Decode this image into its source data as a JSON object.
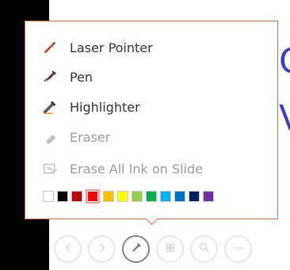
{
  "slide": {
    "visible_text_1": "C",
    "visible_text_2": "V"
  },
  "menu": {
    "items": [
      {
        "label": "Laser Pointer",
        "icon": "laser-pointer-icon",
        "enabled": true
      },
      {
        "label": "Pen",
        "icon": "pen-icon",
        "enabled": true
      },
      {
        "label": "Highlighter",
        "icon": "highlighter-icon",
        "enabled": true
      },
      {
        "label": "Eraser",
        "icon": "eraser-icon",
        "enabled": false
      },
      {
        "label": "Erase All Ink on Slide",
        "icon": "erase-all-ink-icon",
        "enabled": false
      }
    ],
    "colors": [
      {
        "name": "white",
        "hex": "#ffffff",
        "selected": false
      },
      {
        "name": "black",
        "hex": "#000000",
        "selected": false
      },
      {
        "name": "dark-red",
        "hex": "#c00000",
        "selected": false
      },
      {
        "name": "red",
        "hex": "#ff0000",
        "selected": true
      },
      {
        "name": "orange",
        "hex": "#ffc000",
        "selected": false
      },
      {
        "name": "yellow",
        "hex": "#ffff00",
        "selected": false
      },
      {
        "name": "light-green",
        "hex": "#92d050",
        "selected": false
      },
      {
        "name": "green",
        "hex": "#00b050",
        "selected": false
      },
      {
        "name": "light-blue",
        "hex": "#00b0f0",
        "selected": false
      },
      {
        "name": "blue",
        "hex": "#0070c0",
        "selected": false
      },
      {
        "name": "dark-blue",
        "hex": "#002060",
        "selected": false
      },
      {
        "name": "purple",
        "hex": "#7030a0",
        "selected": false
      }
    ],
    "accent_border": "#d66b4f"
  },
  "toolbar": {
    "buttons": [
      {
        "icon": "previous-icon",
        "active": false
      },
      {
        "icon": "next-icon",
        "active": false
      },
      {
        "icon": "pen-tool-icon",
        "active": true
      },
      {
        "icon": "see-all-slides-icon",
        "active": false
      },
      {
        "icon": "zoom-icon",
        "active": false
      },
      {
        "icon": "more-options-icon",
        "active": false
      }
    ]
  }
}
